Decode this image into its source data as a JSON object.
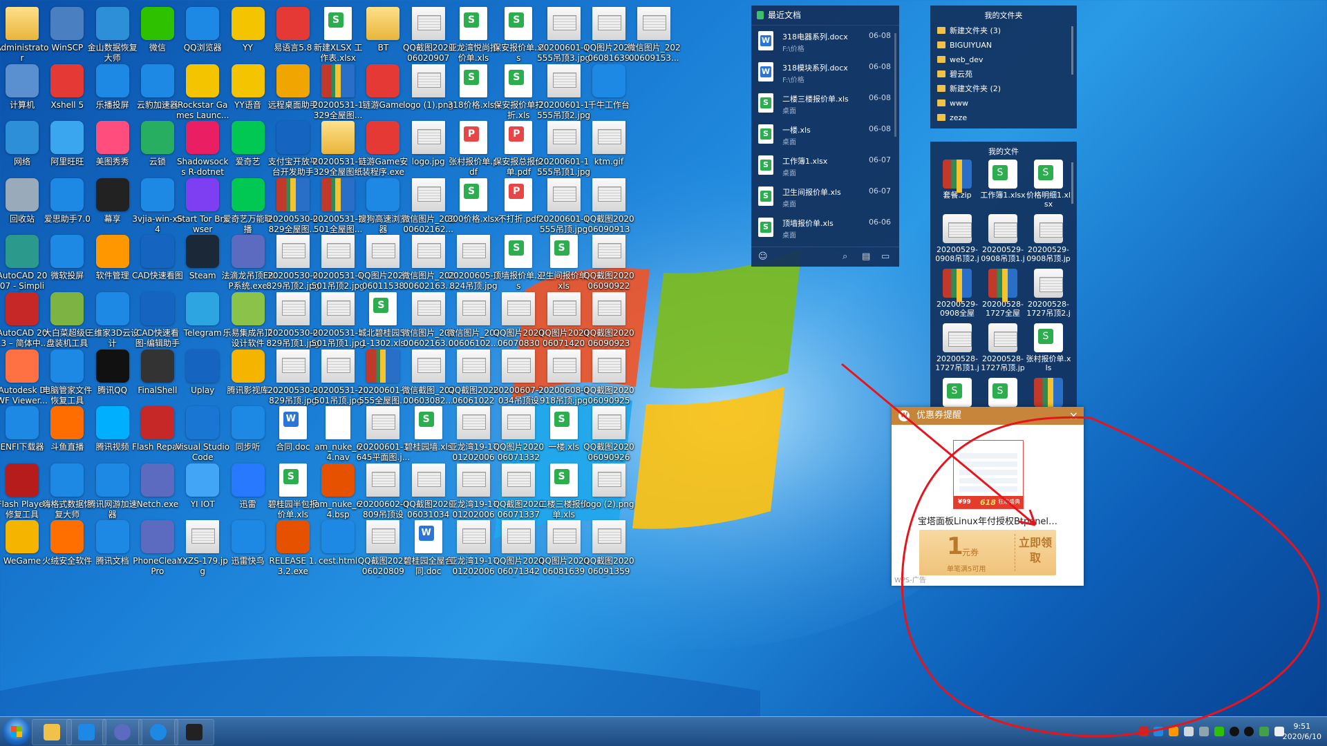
{
  "desktop_icons": [
    {
      "label": "Administrator",
      "type": "folder",
      "color": "#f2c14e"
    },
    {
      "label": "WinSCP",
      "type": "app",
      "color": "#4a7fc1"
    },
    {
      "label": "金山数据恢复大师",
      "type": "app",
      "color": "#2d8fd8"
    },
    {
      "label": "微信",
      "type": "app",
      "color": "#2dc100"
    },
    {
      "label": "QQ浏览器",
      "type": "app",
      "color": "#1e88e5"
    },
    {
      "label": "YY",
      "type": "app",
      "color": "#f5c400"
    },
    {
      "label": "易语言5.8",
      "type": "app",
      "color": "#e53935"
    },
    {
      "label": "新建XLSX 工作表.xlsx",
      "type": "sheet"
    },
    {
      "label": "BT",
      "type": "folder"
    },
    {
      "label": "QQ截图2020060209072...",
      "type": "img"
    },
    {
      "label": "亚龙湾悦尚报价单.xls",
      "type": "sheet"
    },
    {
      "label": "保安报价单.xls",
      "type": "sheet"
    },
    {
      "label": "20200601-1555吊顶3.jpg",
      "type": "img"
    },
    {
      "label": "QQ图片2020060816395...",
      "type": "img"
    },
    {
      "label": "微信图片_20200609153...",
      "type": "img"
    },
    {
      "label": "计算机",
      "type": "app",
      "color": "#5a8fd0"
    },
    {
      "label": "Xshell 5",
      "type": "app",
      "color": "#e53935"
    },
    {
      "label": "乐播投屏",
      "type": "app",
      "color": "#1e88e5"
    },
    {
      "label": "云豹加速器",
      "type": "app",
      "color": "#1e88e5"
    },
    {
      "label": "Rockstar Games Launc...",
      "type": "app",
      "color": "#f5c400"
    },
    {
      "label": "YY语音",
      "type": "app",
      "color": "#f5c400"
    },
    {
      "label": "远程桌面助手",
      "type": "app",
      "color": "#f0a500"
    },
    {
      "label": "20200531-1329全屋图...",
      "type": "zip"
    },
    {
      "label": "链游Game",
      "type": "app",
      "color": "#e53935"
    },
    {
      "label": "logo (1).png",
      "type": "img"
    },
    {
      "label": "318价格.xlsx",
      "type": "sheet"
    },
    {
      "label": "保安报价单打折.xls",
      "type": "sheet"
    },
    {
      "label": "20200601-1555吊顶2.jpg",
      "type": "img"
    },
    {
      "label": "千牛工作台",
      "type": "app",
      "color": "#1e88e5"
    },
    {
      "label": "",
      "type": "none"
    },
    {
      "label": "网络",
      "type": "app",
      "color": "#2d8fd8"
    },
    {
      "label": "阿里旺旺",
      "type": "app",
      "color": "#3aa6f0"
    },
    {
      "label": "美图秀秀",
      "type": "app",
      "color": "#ff4d7d"
    },
    {
      "label": "云锁",
      "type": "app",
      "color": "#27ae60"
    },
    {
      "label": "Shadowsocks R-dotnet4...",
      "type": "app",
      "color": "#e91e63"
    },
    {
      "label": "爱奇艺",
      "type": "app",
      "color": "#00c853"
    },
    {
      "label": "支付宝开放平台开发助手",
      "type": "app",
      "color": "#1565c0"
    },
    {
      "label": "20200531-1329全屋图纸",
      "type": "folder"
    },
    {
      "label": "链游Game安装程序.exe",
      "type": "app",
      "color": "#e53935"
    },
    {
      "label": "logo.jpg",
      "type": "img"
    },
    {
      "label": "张村报价单.pdf",
      "type": "pdf"
    },
    {
      "label": "保安报总报价单.pdf",
      "type": "pdf"
    },
    {
      "label": "20200601-1555吊顶1.jpg",
      "type": "img"
    },
    {
      "label": "ktm.gif",
      "type": "img"
    },
    {
      "label": "",
      "type": "none"
    },
    {
      "label": "回收站",
      "type": "app",
      "color": "#9ab"
    },
    {
      "label": "爱思助手7.0",
      "type": "app",
      "color": "#1e88e5"
    },
    {
      "label": "幕享",
      "type": "app",
      "color": "#222"
    },
    {
      "label": "3vjia-win-x64",
      "type": "app",
      "color": "#1e88e5"
    },
    {
      "label": "Start Tor Browser",
      "type": "app",
      "color": "#7e3ff2"
    },
    {
      "label": "爱奇艺万能联播",
      "type": "app",
      "color": "#00c853"
    },
    {
      "label": "20200530-0829全屋图...",
      "type": "zip"
    },
    {
      "label": "20200531-1501全屋图...",
      "type": "zip"
    },
    {
      "label": "搜狗高速浏览器",
      "type": "app",
      "color": "#1e88e5"
    },
    {
      "label": "微信图片_20200602162...",
      "type": "img"
    },
    {
      "label": "300价格.xlsx",
      "type": "sheet"
    },
    {
      "label": "不打折.pdf",
      "type": "pdf"
    },
    {
      "label": "20200601-1555吊顶.jpg",
      "type": "img"
    },
    {
      "label": "QQ截图2020060909130...",
      "type": "img"
    },
    {
      "label": "",
      "type": "none"
    },
    {
      "label": "AutoCAD 2007 - Simplif...",
      "type": "app",
      "color": "#2b9a8c"
    },
    {
      "label": "微软投屏",
      "type": "app",
      "color": "#1e88e5"
    },
    {
      "label": "软件管理",
      "type": "app",
      "color": "#ff9800"
    },
    {
      "label": "CAD快速看图",
      "type": "app",
      "color": "#1565c0"
    },
    {
      "label": "Steam",
      "type": "app",
      "color": "#1b2838"
    },
    {
      "label": "法滴龙吊顶ERP系统.exe",
      "type": "app",
      "color": "#5c6bc0"
    },
    {
      "label": "20200530-0829吊顶2.jpg",
      "type": "img"
    },
    {
      "label": "20200531-1501吊顶2.jpg",
      "type": "img"
    },
    {
      "label": "QQ图片2020060115380...",
      "type": "img"
    },
    {
      "label": "微信图片_20200602163...",
      "type": "img"
    },
    {
      "label": "20200605-0824吊顶.jpg",
      "type": "img"
    },
    {
      "label": "顶墙报价单.xls",
      "type": "sheet"
    },
    {
      "label": "卫生间报价单.xls",
      "type": "sheet"
    },
    {
      "label": "QQ截图2020060909220...",
      "type": "img"
    },
    {
      "label": "",
      "type": "none"
    },
    {
      "label": "AutoCAD 2013 – 简体中...",
      "type": "app",
      "color": "#c62828"
    },
    {
      "label": "大白菜超级U盘装机工具",
      "type": "app",
      "color": "#7cb342"
    },
    {
      "label": "三维家3D云设计",
      "type": "app",
      "color": "#1e88e5"
    },
    {
      "label": "CAD快速看图-编辑助手",
      "type": "app",
      "color": "#1565c0"
    },
    {
      "label": "Telegram",
      "type": "app",
      "color": "#2ca5e0"
    },
    {
      "label": "乐易集成吊顶设计软件",
      "type": "app",
      "color": "#8bc34a"
    },
    {
      "label": "20200530-0829吊顶1.jpg",
      "type": "img"
    },
    {
      "label": "20200531-1501吊顶1.jpg",
      "type": "img"
    },
    {
      "label": "城北碧桂园5-1-1302.xls",
      "type": "sheet"
    },
    {
      "label": "微信图片_20200602163...",
      "type": "img"
    },
    {
      "label": "微信图片_20200606102...",
      "type": "img"
    },
    {
      "label": "QQ图片2020060708304...",
      "type": "img"
    },
    {
      "label": "QQ图片2020060714203...",
      "type": "img"
    },
    {
      "label": "QQ截图2020060909234...",
      "type": "img"
    },
    {
      "label": "",
      "type": "none"
    },
    {
      "label": "Autodesk DWF Viewer...",
      "type": "app",
      "color": "#ff7043"
    },
    {
      "label": "电脑管家文件恢复工具",
      "type": "app",
      "color": "#1e88e5"
    },
    {
      "label": "腾讯QQ",
      "type": "app",
      "color": "#111"
    },
    {
      "label": "FinalShell",
      "type": "app",
      "color": "#333"
    },
    {
      "label": "Uplay",
      "type": "app",
      "color": "#1565c0"
    },
    {
      "label": "腾讯影视库",
      "type": "app",
      "color": "#f5b400"
    },
    {
      "label": "20200530-0829吊顶.jpg",
      "type": "img"
    },
    {
      "label": "20200531-1501吊顶.jpg",
      "type": "img"
    },
    {
      "label": "20200601-1555全屋图...",
      "type": "zip"
    },
    {
      "label": "微信截图_20200603082...",
      "type": "img"
    },
    {
      "label": "QQ截图2020060610222...",
      "type": "img"
    },
    {
      "label": "20200607-1034吊顶设计...",
      "type": "img"
    },
    {
      "label": "20200608-0918吊顶.jpg",
      "type": "img"
    },
    {
      "label": "QQ截图2020060909250...",
      "type": "img"
    },
    {
      "label": "",
      "type": "none"
    },
    {
      "label": "ENFI下载器",
      "type": "app",
      "color": "#1e88e5"
    },
    {
      "label": "斗鱼直播",
      "type": "app",
      "color": "#ff6d00"
    },
    {
      "label": "腾讯视频",
      "type": "app",
      "color": "#00b0ff"
    },
    {
      "label": "Flash Repair",
      "type": "app",
      "color": "#c62828"
    },
    {
      "label": "Visual Studio Code",
      "type": "app",
      "color": "#1976d2"
    },
    {
      "label": "同步听",
      "type": "app",
      "color": "#1e88e5"
    },
    {
      "label": "合同.doc",
      "type": "doc"
    },
    {
      "label": "am_nuke_64.nav",
      "type": "blank"
    },
    {
      "label": "20200601-1645平面图.j...",
      "type": "img"
    },
    {
      "label": "碧桂园墙.xls",
      "type": "sheet"
    },
    {
      "label": "亚龙湾19-17012020060...",
      "type": "img"
    },
    {
      "label": "QQ图片2020060713323...",
      "type": "img"
    },
    {
      "label": "一楼.xls",
      "type": "sheet"
    },
    {
      "label": "QQ截图2020060909263...",
      "type": "img"
    },
    {
      "label": "",
      "type": "none"
    },
    {
      "label": "Flash Player 修复工具",
      "type": "app",
      "color": "#b71c1c"
    },
    {
      "label": "嗨格式数据恢复大师",
      "type": "app",
      "color": "#1e88e5"
    },
    {
      "label": "腾讯网游加速器",
      "type": "app",
      "color": "#1e88e5"
    },
    {
      "label": "Netch.exe",
      "type": "app",
      "color": "#5c6bc0"
    },
    {
      "label": "YI IOT",
      "type": "app",
      "color": "#42a5f5"
    },
    {
      "label": "迅雷",
      "type": "app",
      "color": "#2979ff"
    },
    {
      "label": "碧桂园半包报价单.xls",
      "type": "sheet"
    },
    {
      "label": "am_nuke_64.bsp",
      "type": "app",
      "color": "#e65100"
    },
    {
      "label": "20200602-0809吊顶设计...",
      "type": "img"
    },
    {
      "label": "QQ截图2020060310344...",
      "type": "img"
    },
    {
      "label": "亚龙湾19-17012020060...",
      "type": "img"
    },
    {
      "label": "QQ截图2020060713371...",
      "type": "img"
    },
    {
      "label": "二楼三楼报价单.xls",
      "type": "sheet"
    },
    {
      "label": "logo (2).png",
      "type": "img"
    },
    {
      "label": "",
      "type": "none"
    },
    {
      "label": "WeGame",
      "type": "app",
      "color": "#f5b400"
    },
    {
      "label": "火绒安全软件",
      "type": "app",
      "color": "#ff6f00"
    },
    {
      "label": "腾讯文档",
      "type": "app",
      "color": "#1e88e5"
    },
    {
      "label": "PhoneClean Pro",
      "type": "app",
      "color": "#5c6bc0"
    },
    {
      "label": "YXZS-179.jpg",
      "type": "img"
    },
    {
      "label": "迅雷快鸟",
      "type": "app",
      "color": "#1e88e5"
    },
    {
      "label": "RELEASE 1.3.2.exe",
      "type": "app",
      "color": "#e65100"
    },
    {
      "label": "cest.html",
      "type": "app",
      "color": "#1e88e5"
    },
    {
      "label": "QQ截图2020060208092...",
      "type": "img"
    },
    {
      "label": "碧桂园全屋合同.doc",
      "type": "doc"
    },
    {
      "label": "亚龙湾19-17012020060...",
      "type": "img"
    },
    {
      "label": "QQ图片2020060713422...",
      "type": "img"
    },
    {
      "label": "QQ图片2020060816394...",
      "type": "img"
    },
    {
      "label": "QQ截图2020060913595...",
      "type": "img"
    },
    {
      "label": "",
      "type": "none"
    }
  ],
  "recent_panel": {
    "title": "最近文档",
    "items": [
      {
        "name": "318电器系列.docx",
        "path": "F:\\价格",
        "date": "06-08",
        "type": "doc"
      },
      {
        "name": "318模块系列.docx",
        "path": "F:\\价格",
        "date": "06-08",
        "type": "doc"
      },
      {
        "name": "二楼三楼报价单.xls",
        "path": "桌面",
        "date": "06-08",
        "type": "sheet"
      },
      {
        "name": "一楼.xls",
        "path": "桌面",
        "date": "06-08",
        "type": "sheet"
      },
      {
        "name": "工作簿1.xlsx",
        "path": "桌面",
        "date": "06-07",
        "type": "sheet"
      },
      {
        "name": "卫生间报价单.xls",
        "path": "桌面",
        "date": "06-07",
        "type": "sheet"
      },
      {
        "name": "顶墙报价单.xls",
        "path": "桌面",
        "date": "06-06",
        "type": "sheet"
      }
    ]
  },
  "folders_panel": {
    "title": "我的文件夹",
    "items": [
      "新建文件夹 (3)",
      "BIGUIYUAN",
      "web_dev",
      "碧云苑",
      "新建文件夹 (2)",
      "www",
      "zeze"
    ]
  },
  "myfiles_panel": {
    "title": "我的文件",
    "items": [
      {
        "label": "套餐.zip",
        "type": "zip"
      },
      {
        "label": "工作簿1.xlsx",
        "type": "sheet"
      },
      {
        "label": "价格明细1.xlsx",
        "type": "sheet"
      },
      {
        "label": "20200529-0908吊顶2.jpg",
        "type": "img"
      },
      {
        "label": "20200529-0908吊顶1.jpg",
        "type": "img"
      },
      {
        "label": "20200529-0908吊顶.jpg",
        "type": "img"
      },
      {
        "label": "20200529-0908全屋图...",
        "type": "zip"
      },
      {
        "label": "20200528-1727全屋图...",
        "type": "zip"
      },
      {
        "label": "20200528-1727吊顶2.jpg",
        "type": "img"
      },
      {
        "label": "20200528-1727吊顶1.jpg",
        "type": "img"
      },
      {
        "label": "20200528-1727吊顶.jpg",
        "type": "img"
      },
      {
        "label": "张村报价单.xls",
        "type": "sheet"
      },
      {
        "label": "",
        "type": "sheet"
      },
      {
        "label": "",
        "type": "sheet"
      },
      {
        "label": "",
        "type": "zip"
      }
    ]
  },
  "coupon": {
    "header": "优惠券提醒",
    "close": "×",
    "logo": "W",
    "promo_price": "¥99",
    "promo_tag": "618",
    "promo_side": "狂欢盛典",
    "title": "宝塔面板Linux年付授权Btpanel…",
    "amount": "1",
    "unit": "元券",
    "condition": "单笔满5可用",
    "button": "立即领取",
    "ad_label": "WPS-广告"
  },
  "taskbar": {
    "clock_time": "9:51",
    "clock_date": "2020/6/10",
    "buttons": [
      "explorer",
      "3vjia",
      "erp",
      "browser",
      "app"
    ]
  },
  "colors": {
    "panel_bg": "#12305c",
    "coupon_header": "#c6853a",
    "annotation": "#e8141c"
  }
}
